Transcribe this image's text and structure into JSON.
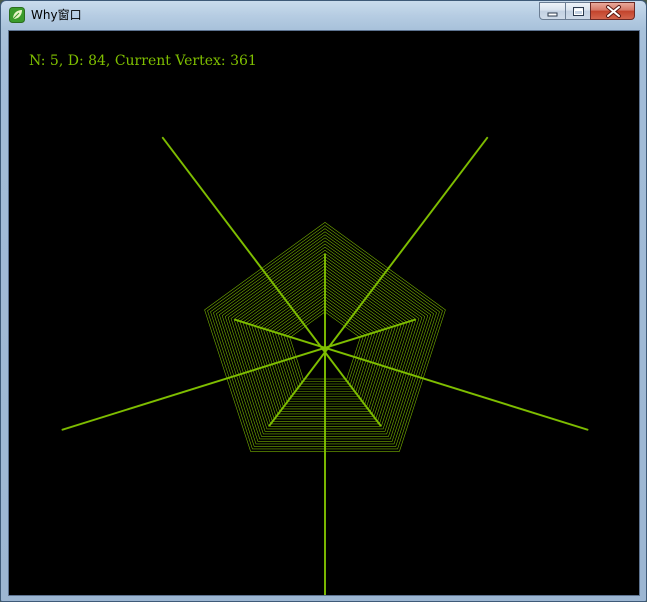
{
  "window": {
    "title": "Why窗口"
  },
  "caption_buttons": {
    "minimize_icon": "minimize-icon",
    "maximize_icon": "maximize-icon",
    "close_icon": "close-icon"
  },
  "canvas": {
    "status_text": "N: 5, D: 84, Current Vertex: 361",
    "line_color": "#7fbf00",
    "background_color": "#000000"
  }
}
